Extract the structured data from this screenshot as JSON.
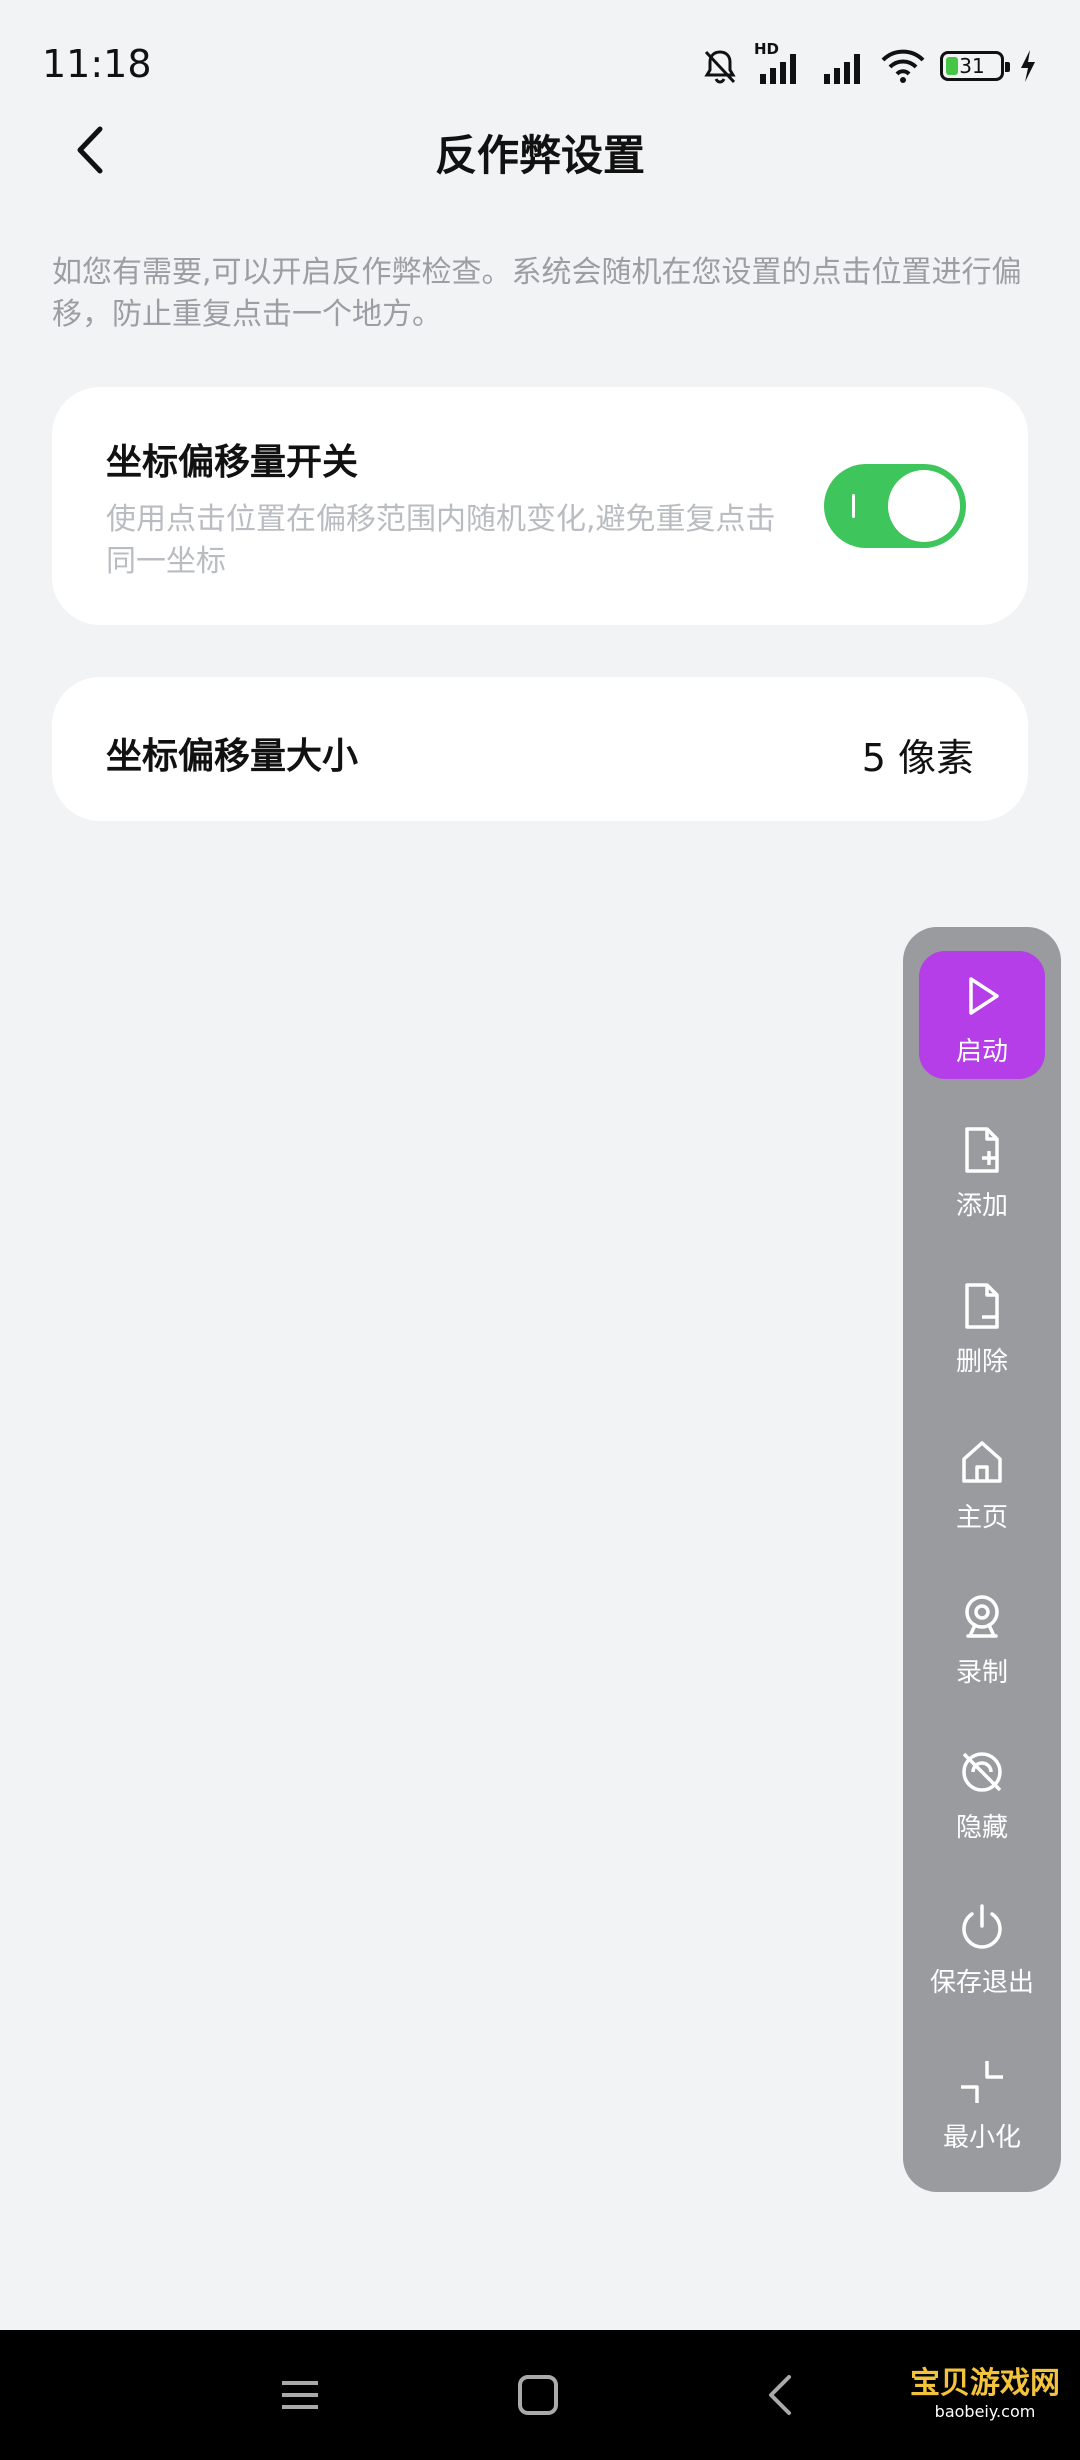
{
  "status_bar": {
    "time": "11:18",
    "network_label": "HD",
    "battery": "31",
    "icons": [
      "bell-muted-icon",
      "signal-icon",
      "signal-icon",
      "wifi-icon",
      "battery-icon",
      "charging-icon"
    ]
  },
  "header": {
    "title": "反作弊设置"
  },
  "description": "如您有需要,可以开启反作弊检查。系统会随机在您设置的点击位置进行偏移，防止重复点击一个地方。",
  "offset_toggle": {
    "title": "坐标偏移量开关",
    "description": "使用点击位置在偏移范围内随机变化,避免重复点击同一坐标",
    "enabled": true,
    "color_on": "#3ec55b"
  },
  "offset_size": {
    "label": "坐标偏移量大小",
    "value": "5 像素"
  },
  "floating_panel": {
    "accent": "#b63ee8",
    "items": [
      {
        "label": "启动",
        "icon": "play-icon"
      },
      {
        "label": "添加",
        "icon": "file-add-icon"
      },
      {
        "label": "删除",
        "icon": "file-remove-icon"
      },
      {
        "label": "主页",
        "icon": "home-icon"
      },
      {
        "label": "录制",
        "icon": "webcam-icon"
      },
      {
        "label": "隐藏",
        "icon": "hide-icon"
      },
      {
        "label": "保存退出",
        "icon": "power-icon"
      },
      {
        "label": "最小化",
        "icon": "minimize-icon"
      }
    ]
  },
  "watermark": {
    "main": "宝贝游戏网",
    "sub": "baobeiy.com"
  }
}
